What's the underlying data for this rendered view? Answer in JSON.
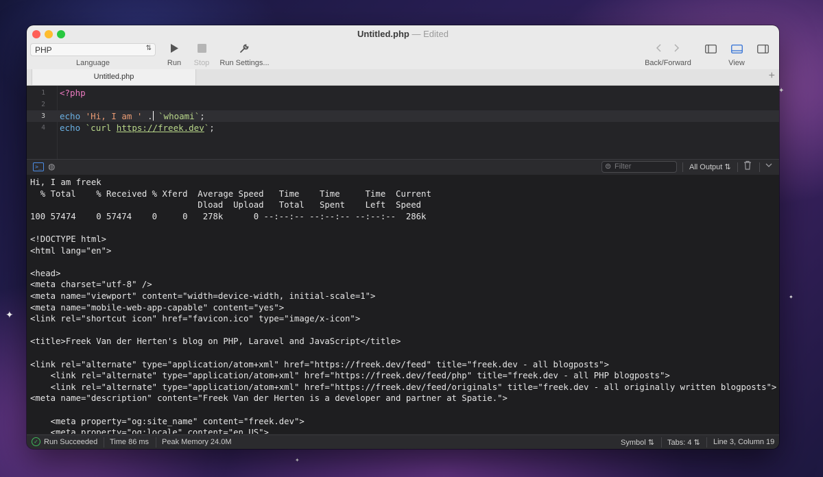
{
  "window": {
    "filename": "Untitled.php",
    "separator": "—",
    "state": "Edited"
  },
  "toolbar": {
    "language_value": "PHP",
    "language_label": "Language",
    "run_label": "Run",
    "stop_label": "Stop",
    "run_settings_label": "Run Settings...",
    "back_forward_label": "Back/Forward",
    "view_label": "View"
  },
  "tabs": [
    {
      "label": "Untitled.php"
    }
  ],
  "editor": {
    "current_line": 3,
    "lines": [
      {
        "number": "1",
        "text": "<?php"
      },
      {
        "number": "2",
        "text": ""
      },
      {
        "number": "3",
        "text": "echo 'Hi, I am ' . `whoami`;"
      },
      {
        "number": "4",
        "text": "echo `curl https://freek.dev`;"
      }
    ],
    "line3_parts": [
      "echo",
      "'Hi, I am '",
      ".",
      "`whoami`",
      ";"
    ],
    "line4_parts": [
      "echo",
      "`curl ",
      "https://freek.dev",
      "`",
      ";"
    ]
  },
  "console": {
    "filter_placeholder": "Filter",
    "output_selector": "All Output",
    "lines": [
      "Hi, I am freek",
      "  % Total    % Received % Xferd  Average Speed   Time    Time     Time  Current",
      "                                 Dload  Upload   Total   Spent    Left  Speed",
      "100 57474    0 57474    0     0   278k      0 --:--:-- --:--:-- --:--:--  286k",
      "",
      "<!DOCTYPE html>",
      "<html lang=\"en\">",
      "",
      "<head>",
      "<meta charset=\"utf-8\" />",
      "<meta name=\"viewport\" content=\"width=device-width, initial-scale=1\">",
      "<meta name=\"mobile-web-app-capable\" content=\"yes\">",
      "<link rel=\"shortcut icon\" href=\"favicon.ico\" type=\"image/x-icon\">",
      "",
      "<title>Freek Van der Herten's blog on PHP, Laravel and JavaScript</title>",
      "",
      "<link rel=\"alternate\" type=\"application/atom+xml\" href=\"https://freek.dev/feed\" title=\"freek.dev - all blogposts\">",
      "    <link rel=\"alternate\" type=\"application/atom+xml\" href=\"https://freek.dev/feed/php\" title=\"freek.dev - all PHP blogposts\">",
      "    <link rel=\"alternate\" type=\"application/atom+xml\" href=\"https://freek.dev/feed/originals\" title=\"freek.dev - all originally written blogposts\">",
      "<meta name=\"description\" content=\"Freek Van der Herten is a developer and partner at Spatie.\">",
      "",
      "    <meta property=\"og:site_name\" content=\"freek.dev\">",
      "    <meta property=\"og:locale\" content=\"en_US\">"
    ]
  },
  "status": {
    "run_result": "Run Succeeded",
    "time": "Time 86 ms",
    "memory": "Peak Memory 24.0M",
    "symbol": "Symbol",
    "tabs": "Tabs: 4",
    "position": "Line 3, Column 19"
  },
  "icons": {
    "language_chevron": "up-down-chevron-icon",
    "run": "play-icon",
    "stop": "stop-icon",
    "run_settings": "wrench-icon",
    "back": "chevron-left-icon",
    "forward": "chevron-right-icon",
    "view_left": "sidebar-left-icon",
    "view_bottom": "panel-bottom-icon",
    "view_right": "sidebar-right-icon",
    "add_tab": "plus-icon",
    "console_terminal": "terminal-icon",
    "console_web": "globe-icon",
    "filter": "filter-icon",
    "trash": "trash-icon",
    "collapse": "chevron-down-icon",
    "success": "checkmark-circle-icon"
  },
  "colors": {
    "accent": "#4c8ee8",
    "success": "#3fba5a",
    "php_tag": "#ec7ac0",
    "keyword": "#6ab0e3",
    "string": "#e89a73",
    "backtick": "#b9d78a"
  }
}
